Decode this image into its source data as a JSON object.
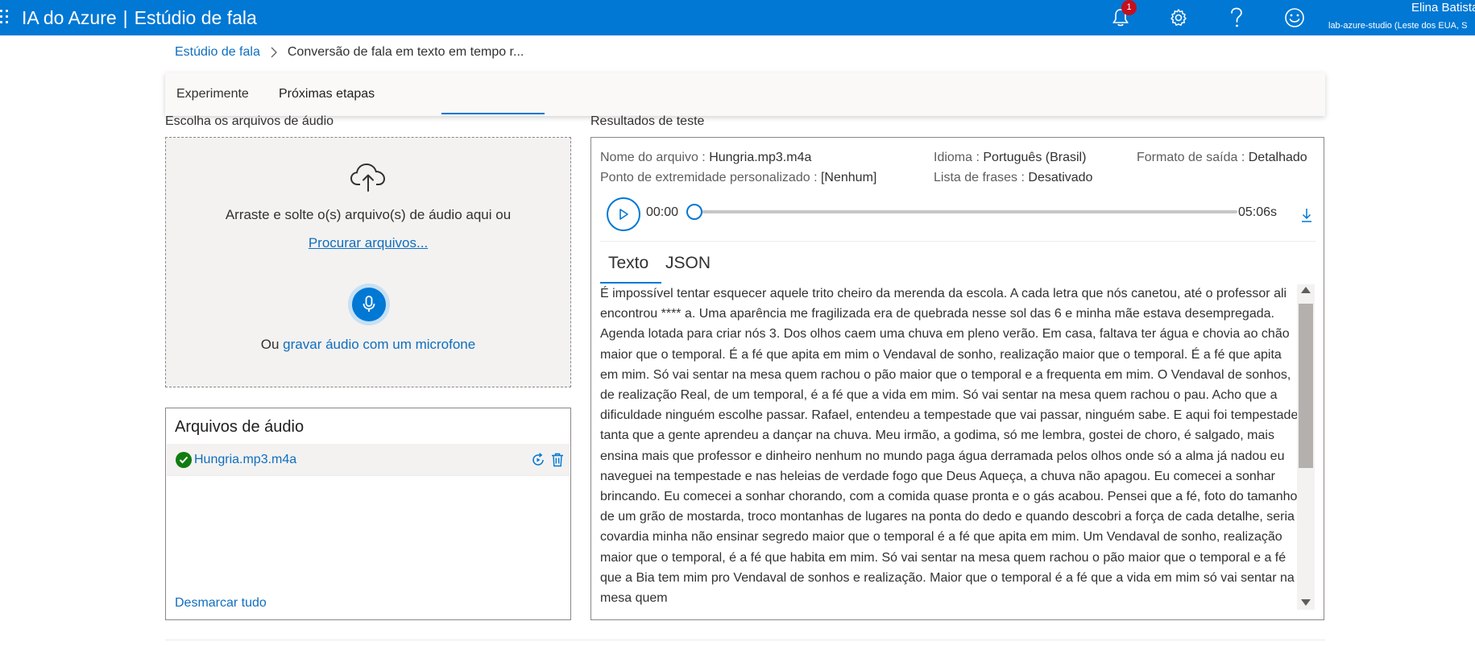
{
  "app": {
    "title_product": "IA do Azure",
    "title_separator": "|",
    "title_studio": "Estúdio de fala",
    "notifications_count": "1",
    "user_name": "Elina Batista",
    "user_tenant": "lab-azure-studio (Leste dos EUA, S"
  },
  "breadcrumb": {
    "root": "Estúdio de fala",
    "current": "Conversão de fala em texto em tempo r..."
  },
  "tabs": {
    "experiment": "Experimente",
    "next_steps": "Próximas etapas"
  },
  "upload": {
    "section_title": "Escolha os arquivos de áudio",
    "drop_text": "Arraste e solte o(s) arquivo(s) de áudio aqui ou",
    "browse_link": "Procurar arquivos...",
    "record_prefix": "Ou ",
    "record_link": "gravar áudio com um microfone"
  },
  "files": {
    "title": "Arquivos de áudio",
    "items": [
      {
        "name": "Hungria.mp3.m4a",
        "status": "success"
      }
    ],
    "deselect_all": "Desmarcar tudo"
  },
  "results": {
    "section_title": "Resultados de teste",
    "file_name_label": "Nome do arquivo :",
    "file_name_value": "Hungria.mp3.m4a",
    "language_label": "Idioma :",
    "language_value": "Português (Brasil)",
    "output_format_label": "Formato de saída :",
    "output_format_value": "Detalhado",
    "endpoint_label": "Ponto de extremidade personalizado :",
    "endpoint_value": "[Nenhum]",
    "phrase_list_label": "Lista de frases :",
    "phrase_list_value": "Desativado",
    "player": {
      "current_time": "00:00",
      "duration": "05:06s",
      "progress": 0
    },
    "result_tabs": {
      "text": "Texto",
      "json": "JSON"
    },
    "transcript": "É impossível tentar esquecer aquele trito cheiro da merenda da escola. A cada letra que nós canetou, até o professor ali encontrou **** a. Uma aparência me fragilizada era de quebrada nesse sol das 6 e minha mãe estava desempregada. Agenda lotada para criar nós 3. Dos olhos caem uma chuva em pleno verão. Em casa, faltava ter água e chovia ao chão maior que o temporal. É a fé que apita em mim o Vendaval de sonho, realização maior que o temporal. É a fé que apita em mim. Só vai sentar na mesa quem rachou o pão maior que o temporal e a frequenta em mim. O Vendaval de sonhos, de realização Real, de um temporal, é a fé que a vida em mim. Só vai sentar na mesa quem rachou o pau. Acho que a dificuldade ninguém escolhe passar. Rafael, entendeu a tempestade que vai passar, ninguém sabe. E aqui foi tempestade tanta que a gente aprendeu a dançar na chuva. Meu irmão, a godima, só me lembra, gostei de choro, é salgado, mais ensina mais que professor e dinheiro nenhum no mundo paga água derramada pelos olhos onde só a alma já nadou eu naveguei na tempestade e nas heleias de verdade fogo que Deus Aqueça, a chuva não apagou. Eu comecei a sonhar brincando. Eu comecei a sonhar chorando, com a comida quase pronta e o gás acabou. Pensei que a fé, foto do tamanho de um grão de mostarda, troco montanhas de lugares na ponta do dedo e quando descobri a força de cada detalhe, seria covardia minha não ensinar segredo maior que o temporal é a fé que apita em mim. Um Vendaval de sonho, realização maior que o temporal, é a fé que habita em mim. Só vai sentar na mesa quem rachou o pão maior que o temporal e a fé que a Bia tem mim pro Vendaval de sonhos e realização. Maior que o temporal é a fé que a vida em mim só vai sentar na mesa quem"
  },
  "icons": {
    "waffle": "waffle-icon",
    "bell": "bell-icon",
    "settings": "gear-icon",
    "help": "help-icon",
    "feedback": "smiley-icon",
    "upload": "cloud-upload-icon",
    "mic": "microphone-icon",
    "check": "check-circle-icon",
    "rerun": "refresh-icon",
    "delete": "trash-icon",
    "play": "play-icon",
    "download": "download-icon"
  },
  "colors": {
    "topbar": "#0078d4",
    "accent": "#0078d4",
    "link": "#106ebe",
    "success": "#107c10",
    "badge": "#c50f1f"
  }
}
